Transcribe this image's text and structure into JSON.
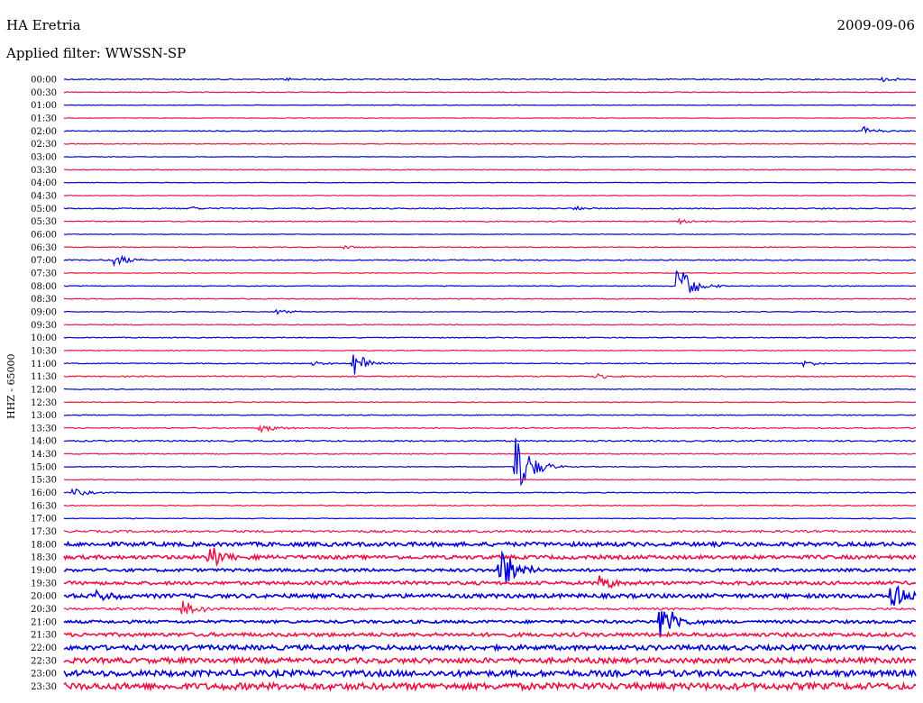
{
  "header": {
    "station": "HA Eretria",
    "date": "2009-09-06",
    "filter": "Applied filter: WWSSN-SP",
    "channel": "HHZ - 65000"
  },
  "colors": {
    "trace_a": "#0000dd",
    "trace_b": "#ee1144"
  },
  "chart_data": {
    "type": "line",
    "title": "HA Eretria",
    "subtitle": "Applied filter: WWSSN-SP",
    "ylabel": "HHZ - 65000",
    "date": "2009-09-06",
    "row_labels": [
      "00:00",
      "00:30",
      "01:00",
      "01:30",
      "02:00",
      "02:30",
      "03:00",
      "03:30",
      "04:00",
      "04:30",
      "05:00",
      "05:30",
      "06:00",
      "06:30",
      "07:00",
      "07:30",
      "08:00",
      "08:30",
      "09:00",
      "09:30",
      "10:00",
      "10:30",
      "11:00",
      "11:30",
      "12:00",
      "12:30",
      "13:00",
      "13:30",
      "14:00",
      "14:30",
      "15:00",
      "15:30",
      "16:00",
      "16:30",
      "17:00",
      "17:30",
      "18:00",
      "18:30",
      "19:00",
      "19:30",
      "20:00",
      "20:30",
      "21:00",
      "21:30",
      "22:00",
      "22:30",
      "23:00",
      "23:30"
    ],
    "row_noise": [
      0.6,
      0.4,
      0.3,
      0.3,
      0.5,
      0.4,
      0.3,
      0.4,
      0.3,
      0.3,
      0.6,
      0.5,
      0.3,
      0.4,
      0.6,
      0.4,
      0.4,
      0.5,
      0.4,
      0.4,
      0.5,
      0.4,
      0.5,
      0.6,
      0.4,
      0.4,
      0.5,
      0.6,
      0.8,
      0.5,
      0.4,
      0.4,
      0.5,
      0.5,
      0.4,
      1.2,
      2.2,
      2.0,
      1.6,
      1.8,
      2.2,
      1.2,
      1.6,
      2.0,
      2.6,
      2.8,
      3.2,
      3.6
    ],
    "events": [
      {
        "row": "00:00",
        "t": 0.26,
        "amp": 2
      },
      {
        "row": "00:00",
        "t": 0.96,
        "amp": 3
      },
      {
        "row": "02:00",
        "t": 0.94,
        "amp": 5
      },
      {
        "row": "05:00",
        "t": 0.15,
        "amp": 2
      },
      {
        "row": "05:00",
        "t": 0.6,
        "amp": 2
      },
      {
        "row": "05:30",
        "t": 0.72,
        "amp": 4
      },
      {
        "row": "06:30",
        "t": 0.33,
        "amp": 2
      },
      {
        "row": "07:00",
        "t": 0.06,
        "amp": 7
      },
      {
        "row": "08:00",
        "t": 0.72,
        "amp": 26
      },
      {
        "row": "09:00",
        "t": 0.25,
        "amp": 3
      },
      {
        "row": "11:00",
        "t": 0.29,
        "amp": 3
      },
      {
        "row": "11:00",
        "t": 0.34,
        "amp": 14
      },
      {
        "row": "11:00",
        "t": 0.87,
        "amp": 3
      },
      {
        "row": "11:30",
        "t": 0.62,
        "amp": 4
      },
      {
        "row": "13:30",
        "t": 0.23,
        "amp": 5
      },
      {
        "row": "16:00",
        "t": 0.01,
        "amp": 5
      },
      {
        "row": "15:00",
        "t": 0.53,
        "amp": 38
      },
      {
        "row": "18:30",
        "t": 0.17,
        "amp": 14
      },
      {
        "row": "19:00",
        "t": 0.51,
        "amp": 30
      },
      {
        "row": "19:30",
        "t": 0.63,
        "amp": 8
      },
      {
        "row": "20:00",
        "t": 0.97,
        "amp": 22
      },
      {
        "row": "20:00",
        "t": 0.04,
        "amp": 7
      },
      {
        "row": "20:30",
        "t": 0.14,
        "amp": 10
      },
      {
        "row": "21:00",
        "t": 0.7,
        "amp": 24
      }
    ]
  }
}
